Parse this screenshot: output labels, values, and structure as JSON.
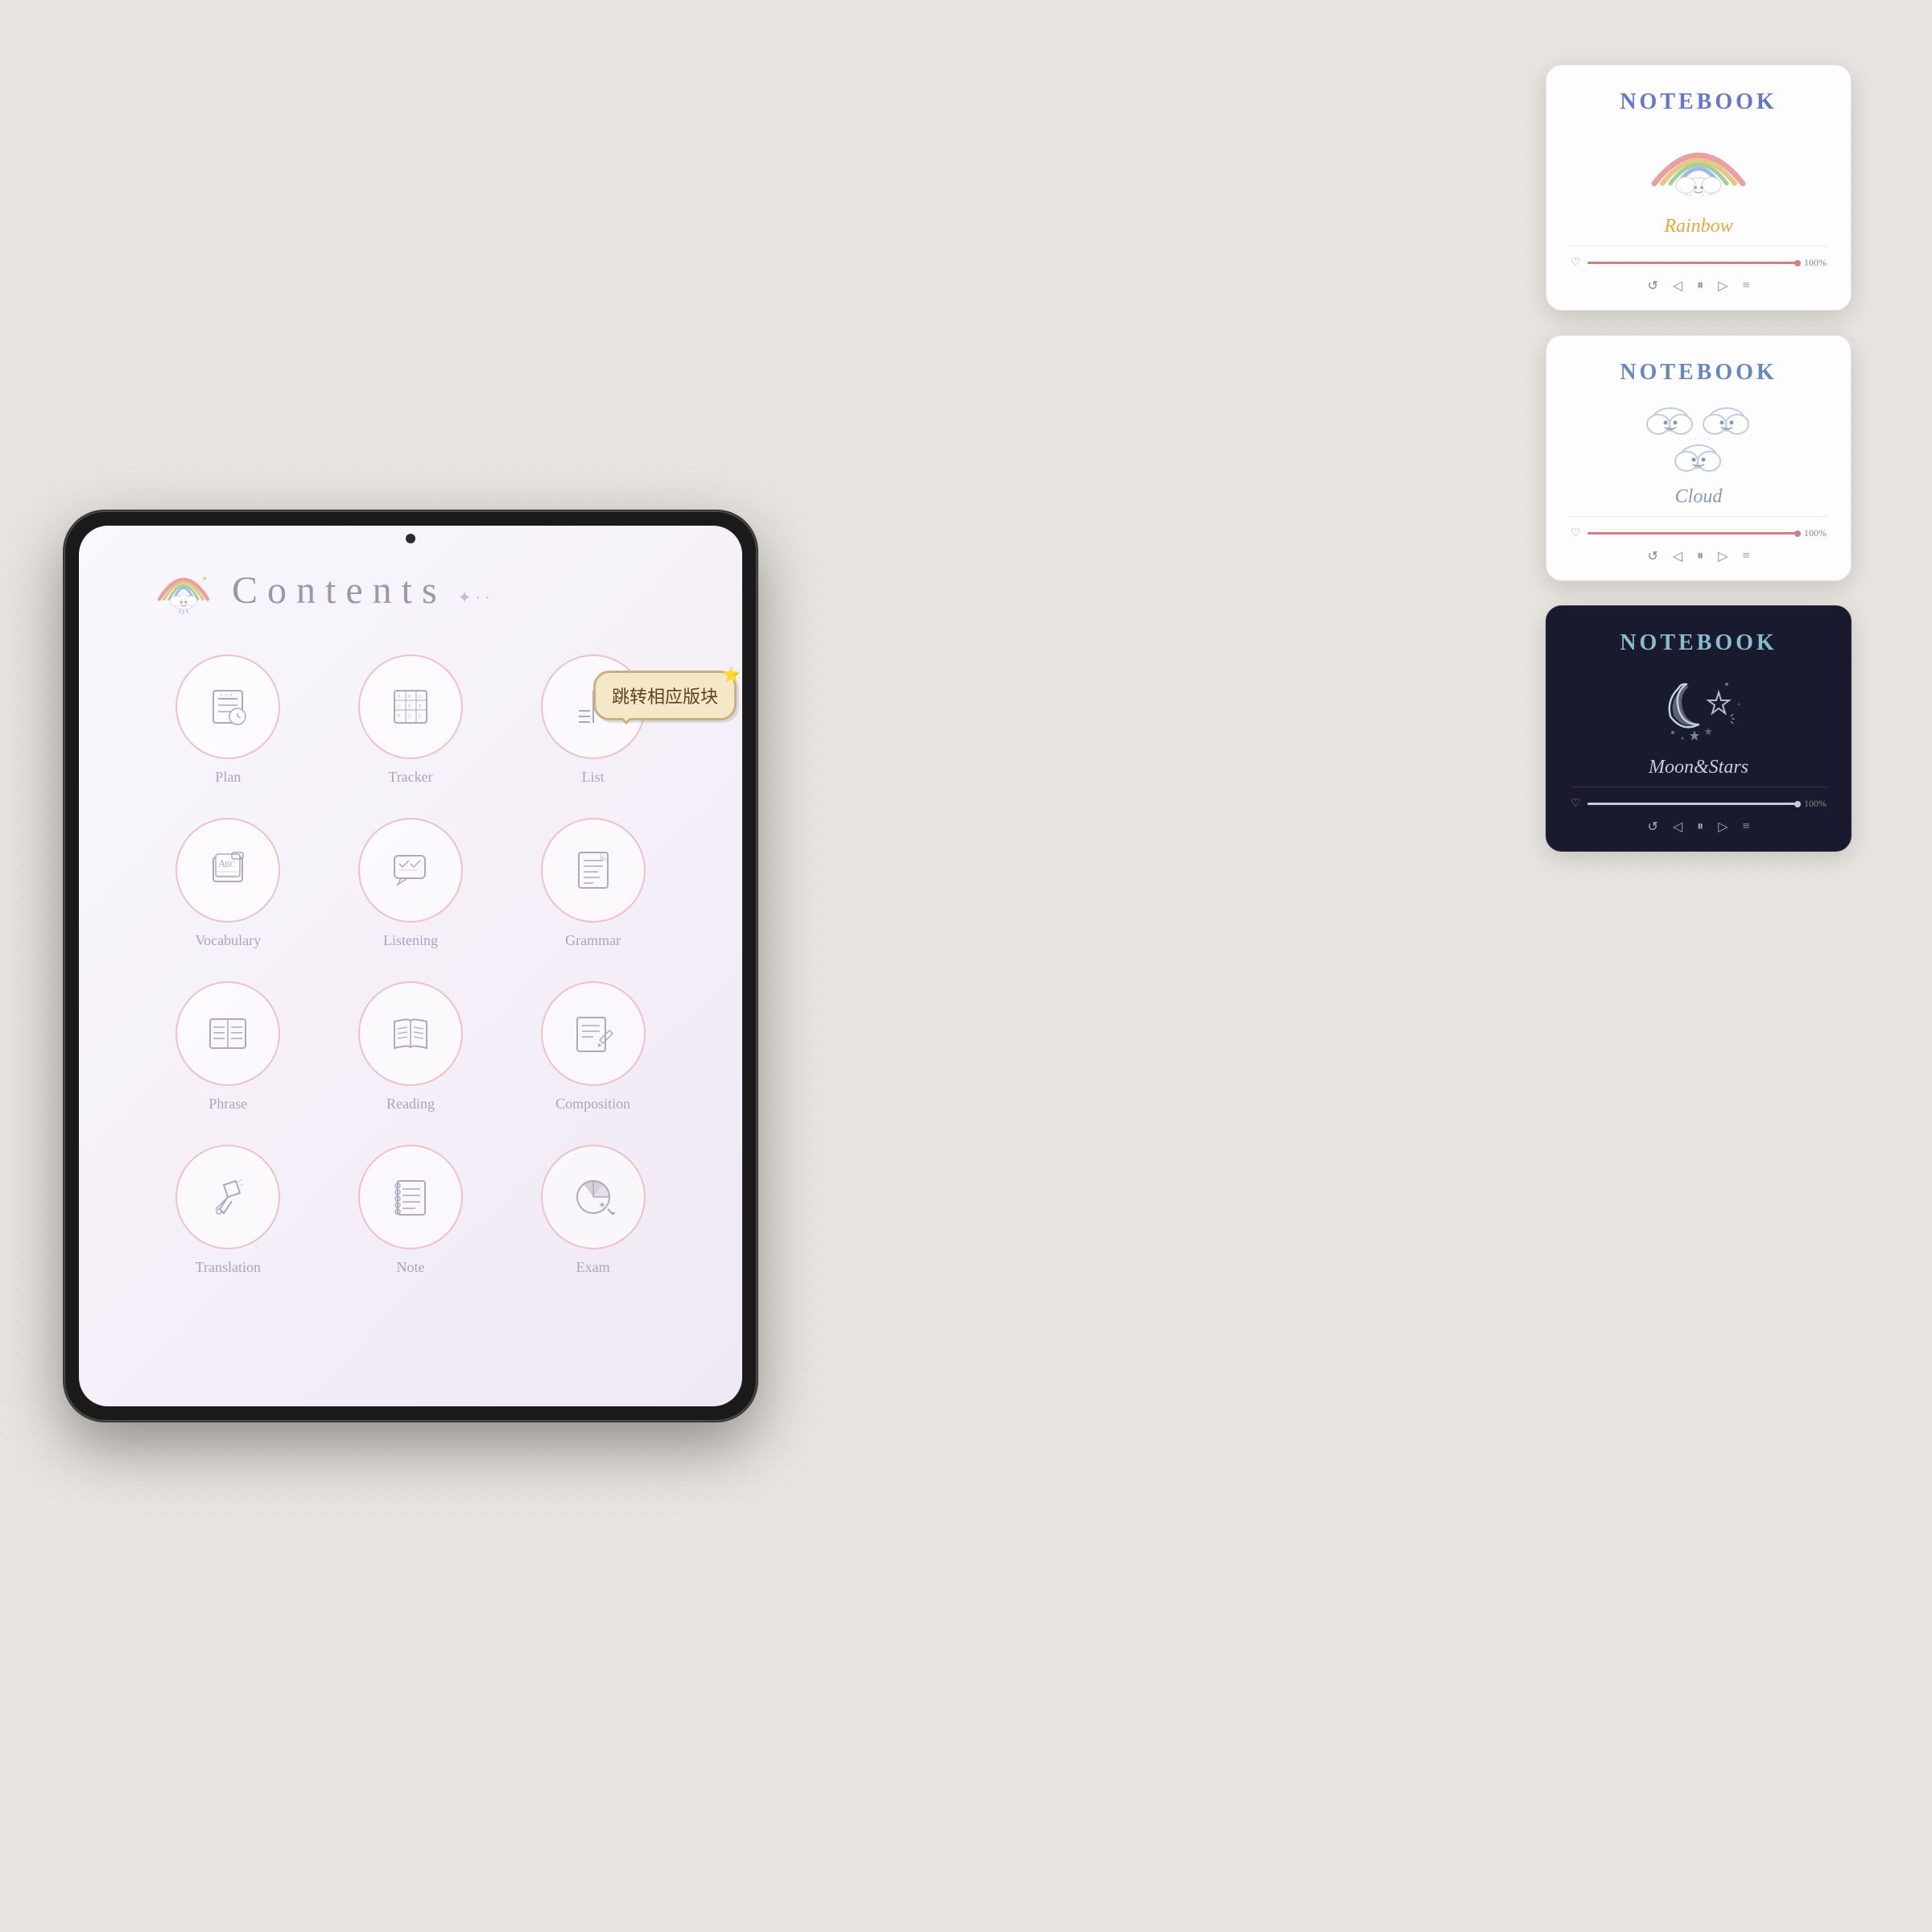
{
  "background": {
    "color": "#e8e4df"
  },
  "ipad": {
    "title": "iPad",
    "screen": {
      "header": {
        "title": "Contents",
        "title_style": "spaced"
      },
      "grid": [
        {
          "id": "plan",
          "label": "Plan",
          "icon": "plan-icon",
          "row": 1,
          "col": 1
        },
        {
          "id": "tracker",
          "label": "Tracker",
          "icon": "tracker-icon",
          "row": 1,
          "col": 2
        },
        {
          "id": "list",
          "label": "List",
          "icon": "list-icon",
          "row": 1,
          "col": 3
        },
        {
          "id": "vocabulary",
          "label": "Vocabulary",
          "icon": "vocabulary-icon",
          "row": 2,
          "col": 1
        },
        {
          "id": "listening",
          "label": "Listening",
          "icon": "listening-icon",
          "row": 2,
          "col": 2
        },
        {
          "id": "grammar",
          "label": "Grammar",
          "icon": "grammar-icon",
          "row": 2,
          "col": 3
        },
        {
          "id": "phrase",
          "label": "Phrase",
          "icon": "phrase-icon",
          "row": 3,
          "col": 1
        },
        {
          "id": "reading",
          "label": "Reading",
          "icon": "reading-icon",
          "row": 3,
          "col": 2
        },
        {
          "id": "composition",
          "label": "Composition",
          "icon": "composition-icon",
          "row": 3,
          "col": 3
        },
        {
          "id": "translation",
          "label": "Translation",
          "icon": "translation-icon",
          "row": 4,
          "col": 1
        },
        {
          "id": "note",
          "label": "Note",
          "icon": "note-icon",
          "row": 4,
          "col": 2
        },
        {
          "id": "exam",
          "label": "Exam",
          "icon": "exam-icon",
          "row": 4,
          "col": 3
        }
      ],
      "tooltip": {
        "text": "跳转相应版块",
        "position": "list-item"
      }
    }
  },
  "notebooks": [
    {
      "id": "rainbow",
      "theme": "rainbow-theme",
      "title": "NOTEBOOK",
      "subtitle": "Rainbow",
      "artwork_type": "rainbow",
      "progress": 100,
      "heart": "♡"
    },
    {
      "id": "cloud",
      "theme": "cloud-theme",
      "title": "NOTEBOOK",
      "subtitle": "Cloud",
      "artwork_type": "cloud",
      "progress": 100,
      "heart": "♡"
    },
    {
      "id": "moon-stars",
      "theme": "dark-theme",
      "title": "NOTEBOOK",
      "subtitle": "Moon&Stars",
      "artwork_type": "moon",
      "progress": 100,
      "heart": "♡"
    }
  ],
  "controls": {
    "repeat": "↺",
    "prev": "◁",
    "play": "⏸",
    "next": "▷",
    "menu": "≡",
    "progress_text": "100%"
  }
}
